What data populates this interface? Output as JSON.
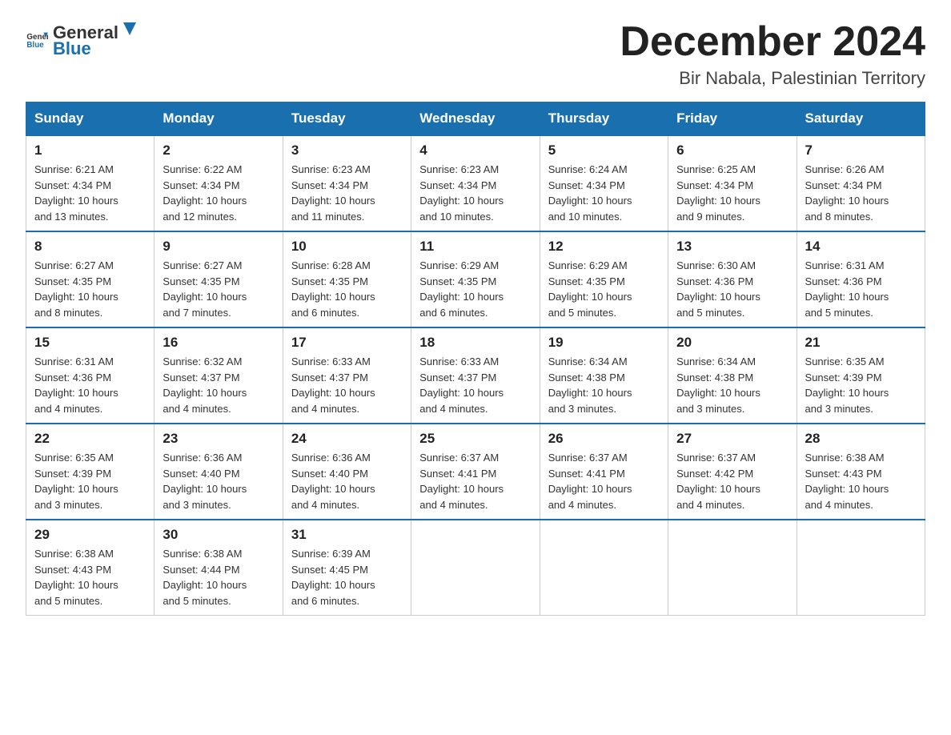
{
  "logo": {
    "text_general": "General",
    "text_blue": "Blue"
  },
  "header": {
    "month_year": "December 2024",
    "location": "Bir Nabala, Palestinian Territory"
  },
  "days_of_week": [
    "Sunday",
    "Monday",
    "Tuesday",
    "Wednesday",
    "Thursday",
    "Friday",
    "Saturday"
  ],
  "weeks": [
    [
      {
        "day": "1",
        "sunrise": "6:21 AM",
        "sunset": "4:34 PM",
        "daylight": "10 hours and 13 minutes."
      },
      {
        "day": "2",
        "sunrise": "6:22 AM",
        "sunset": "4:34 PM",
        "daylight": "10 hours and 12 minutes."
      },
      {
        "day": "3",
        "sunrise": "6:23 AM",
        "sunset": "4:34 PM",
        "daylight": "10 hours and 11 minutes."
      },
      {
        "day": "4",
        "sunrise": "6:23 AM",
        "sunset": "4:34 PM",
        "daylight": "10 hours and 10 minutes."
      },
      {
        "day": "5",
        "sunrise": "6:24 AM",
        "sunset": "4:34 PM",
        "daylight": "10 hours and 10 minutes."
      },
      {
        "day": "6",
        "sunrise": "6:25 AM",
        "sunset": "4:34 PM",
        "daylight": "10 hours and 9 minutes."
      },
      {
        "day": "7",
        "sunrise": "6:26 AM",
        "sunset": "4:34 PM",
        "daylight": "10 hours and 8 minutes."
      }
    ],
    [
      {
        "day": "8",
        "sunrise": "6:27 AM",
        "sunset": "4:35 PM",
        "daylight": "10 hours and 8 minutes."
      },
      {
        "day": "9",
        "sunrise": "6:27 AM",
        "sunset": "4:35 PM",
        "daylight": "10 hours and 7 minutes."
      },
      {
        "day": "10",
        "sunrise": "6:28 AM",
        "sunset": "4:35 PM",
        "daylight": "10 hours and 6 minutes."
      },
      {
        "day": "11",
        "sunrise": "6:29 AM",
        "sunset": "4:35 PM",
        "daylight": "10 hours and 6 minutes."
      },
      {
        "day": "12",
        "sunrise": "6:29 AM",
        "sunset": "4:35 PM",
        "daylight": "10 hours and 5 minutes."
      },
      {
        "day": "13",
        "sunrise": "6:30 AM",
        "sunset": "4:36 PM",
        "daylight": "10 hours and 5 minutes."
      },
      {
        "day": "14",
        "sunrise": "6:31 AM",
        "sunset": "4:36 PM",
        "daylight": "10 hours and 5 minutes."
      }
    ],
    [
      {
        "day": "15",
        "sunrise": "6:31 AM",
        "sunset": "4:36 PM",
        "daylight": "10 hours and 4 minutes."
      },
      {
        "day": "16",
        "sunrise": "6:32 AM",
        "sunset": "4:37 PM",
        "daylight": "10 hours and 4 minutes."
      },
      {
        "day": "17",
        "sunrise": "6:33 AM",
        "sunset": "4:37 PM",
        "daylight": "10 hours and 4 minutes."
      },
      {
        "day": "18",
        "sunrise": "6:33 AM",
        "sunset": "4:37 PM",
        "daylight": "10 hours and 4 minutes."
      },
      {
        "day": "19",
        "sunrise": "6:34 AM",
        "sunset": "4:38 PM",
        "daylight": "10 hours and 3 minutes."
      },
      {
        "day": "20",
        "sunrise": "6:34 AM",
        "sunset": "4:38 PM",
        "daylight": "10 hours and 3 minutes."
      },
      {
        "day": "21",
        "sunrise": "6:35 AM",
        "sunset": "4:39 PM",
        "daylight": "10 hours and 3 minutes."
      }
    ],
    [
      {
        "day": "22",
        "sunrise": "6:35 AM",
        "sunset": "4:39 PM",
        "daylight": "10 hours and 3 minutes."
      },
      {
        "day": "23",
        "sunrise": "6:36 AM",
        "sunset": "4:40 PM",
        "daylight": "10 hours and 3 minutes."
      },
      {
        "day": "24",
        "sunrise": "6:36 AM",
        "sunset": "4:40 PM",
        "daylight": "10 hours and 4 minutes."
      },
      {
        "day": "25",
        "sunrise": "6:37 AM",
        "sunset": "4:41 PM",
        "daylight": "10 hours and 4 minutes."
      },
      {
        "day": "26",
        "sunrise": "6:37 AM",
        "sunset": "4:41 PM",
        "daylight": "10 hours and 4 minutes."
      },
      {
        "day": "27",
        "sunrise": "6:37 AM",
        "sunset": "4:42 PM",
        "daylight": "10 hours and 4 minutes."
      },
      {
        "day": "28",
        "sunrise": "6:38 AM",
        "sunset": "4:43 PM",
        "daylight": "10 hours and 4 minutes."
      }
    ],
    [
      {
        "day": "29",
        "sunrise": "6:38 AM",
        "sunset": "4:43 PM",
        "daylight": "10 hours and 5 minutes."
      },
      {
        "day": "30",
        "sunrise": "6:38 AM",
        "sunset": "4:44 PM",
        "daylight": "10 hours and 5 minutes."
      },
      {
        "day": "31",
        "sunrise": "6:39 AM",
        "sunset": "4:45 PM",
        "daylight": "10 hours and 6 minutes."
      },
      null,
      null,
      null,
      null
    ]
  ],
  "labels": {
    "sunrise": "Sunrise:",
    "sunset": "Sunset:",
    "daylight": "Daylight:"
  }
}
